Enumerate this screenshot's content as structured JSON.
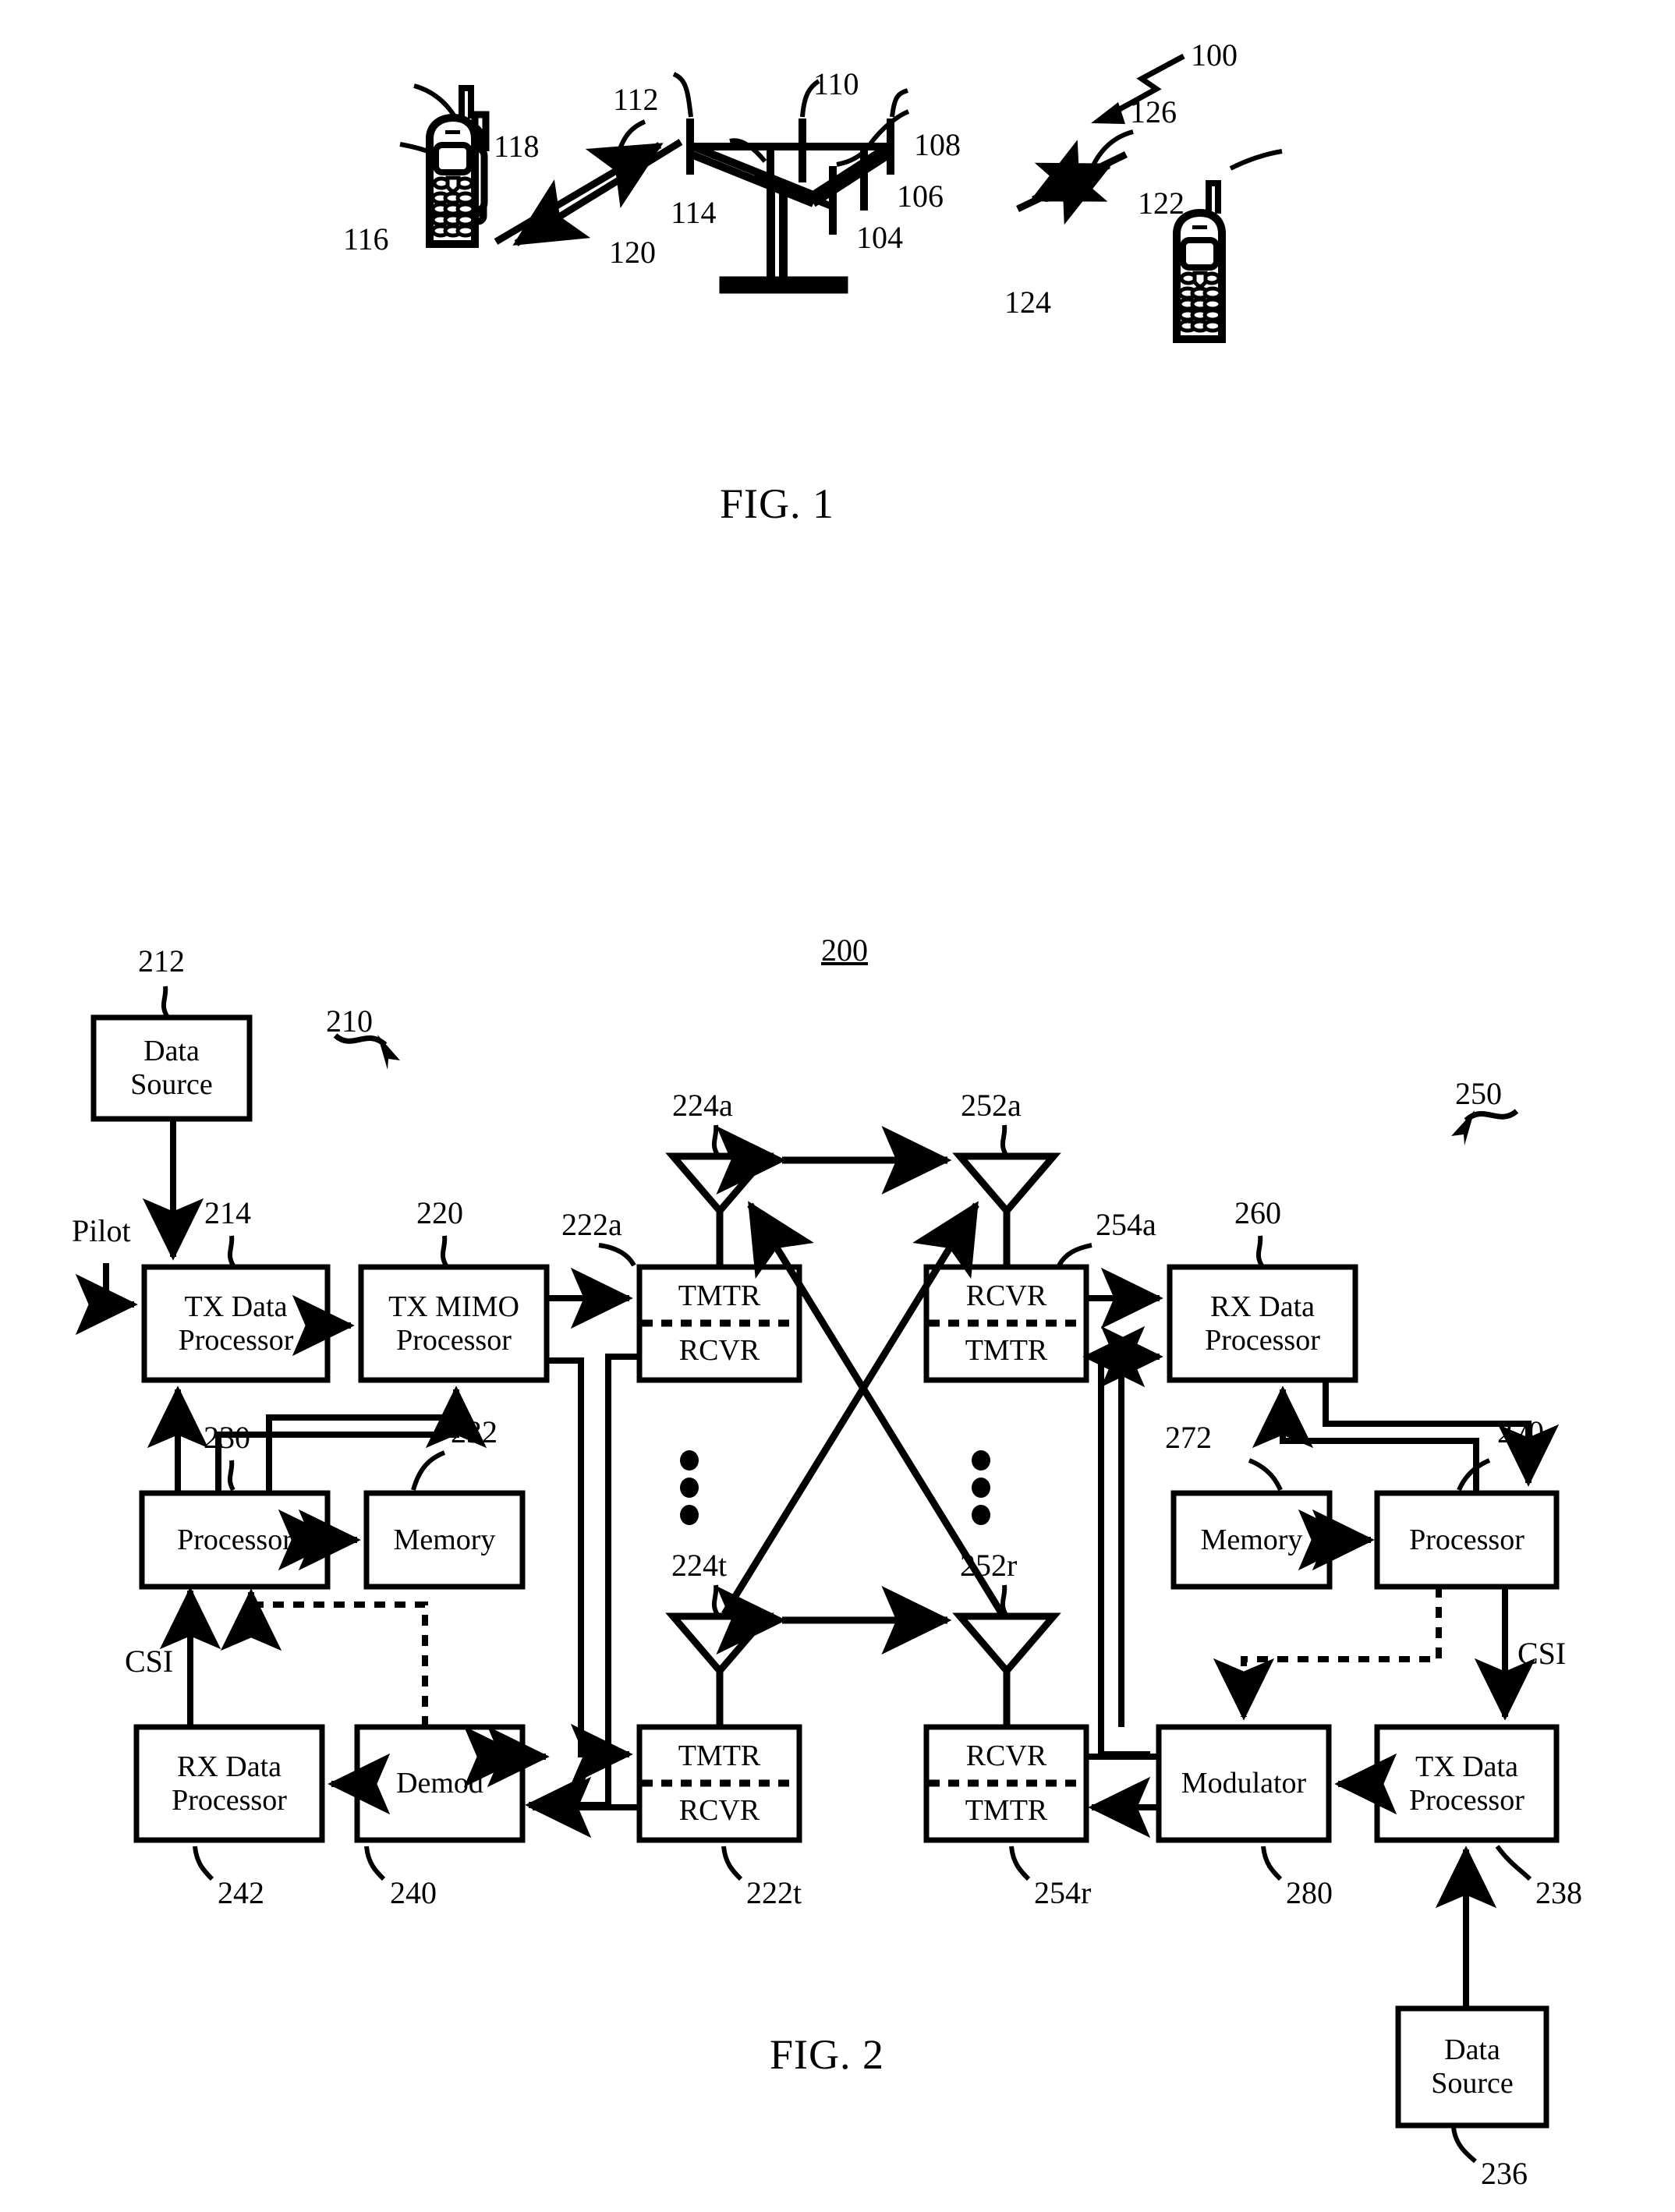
{
  "document": {
    "type": "patent-drawing-sheet",
    "figures": [
      "FIG. 1",
      "FIG. 2"
    ]
  },
  "fig1": {
    "caption": "FIG. 1",
    "system_ref": "100",
    "tower": {
      "ref_antennas_top_left": "112",
      "ref_antenna_top_mid": "110",
      "ref_antenna_top_right": "108",
      "ref_antenna_mid_right": "106",
      "ref_antenna_front_right": "104",
      "ref_antenna_front_left": "114"
    },
    "terminal_left": {
      "ref": "116",
      "uplink_ref": "118",
      "downlink_ref": "120"
    },
    "terminal_right": {
      "ref": "122",
      "uplink_ref": "126",
      "downlink_ref": "124"
    }
  },
  "fig2": {
    "caption": "FIG. 2",
    "system_ref": "200",
    "transmitter_system_ref": "210",
    "receiver_system_ref": "250",
    "signals": {
      "pilot": "Pilot",
      "csi_left": "CSI",
      "csi_right": "CSI"
    },
    "blocks": [
      {
        "id": "b212",
        "label": "Data\nSource",
        "ref": "212"
      },
      {
        "id": "b214",
        "label": "TX Data\nProcessor",
        "ref": "214"
      },
      {
        "id": "b220",
        "label": "TX MIMO\nProcessor",
        "ref": "220"
      },
      {
        "id": "b222a",
        "label_top": "TMTR",
        "label_bottom": "RCVR",
        "ref": "222a"
      },
      {
        "id": "b222t",
        "label_top": "TMTR",
        "label_bottom": "RCVR",
        "ref": "222t"
      },
      {
        "id": "b230",
        "label": "Processor",
        "ref": "230"
      },
      {
        "id": "b232",
        "label": "Memory",
        "ref": "232"
      },
      {
        "id": "b240",
        "label": "Demod",
        "ref": "240"
      },
      {
        "id": "b242",
        "label": "RX Data\nProcessor",
        "ref": "242"
      },
      {
        "id": "b254a",
        "label_top": "RCVR",
        "label_bottom": "TMTR",
        "ref": "254a"
      },
      {
        "id": "b254r",
        "label_top": "RCVR",
        "label_bottom": "TMTR",
        "ref": "254r"
      },
      {
        "id": "b260",
        "label": "RX Data\nProcessor",
        "ref": "260"
      },
      {
        "id": "b270",
        "label": "Processor",
        "ref": "270"
      },
      {
        "id": "b272",
        "label": "Memory",
        "ref": "272"
      },
      {
        "id": "b280",
        "label": "Modulator",
        "ref": "280"
      },
      {
        "id": "b238",
        "label": "TX Data\nProcessor",
        "ref": "238"
      },
      {
        "id": "b236",
        "label": "Data\nSource",
        "ref": "236"
      }
    ],
    "antennas": [
      {
        "id": "a224a",
        "ref": "224a"
      },
      {
        "id": "a224t",
        "ref": "224t"
      },
      {
        "id": "a252a",
        "ref": "252a"
      },
      {
        "id": "a252r",
        "ref": "252r"
      }
    ]
  },
  "labels": {
    "data_source": "Data\nSource",
    "tx_data_processor": "TX Data\nProcessor",
    "tx_mimo_processor": "TX MIMO\nProcessor",
    "rx_data_processor": "RX Data\nProcessor",
    "processor": "Processor",
    "memory": "Memory",
    "demod": "Demod",
    "modulator": "Modulator",
    "tmtr": "TMTR",
    "rcvr": "RCVR"
  },
  "colors": {
    "ink": "#000000",
    "paper": "#ffffff"
  }
}
